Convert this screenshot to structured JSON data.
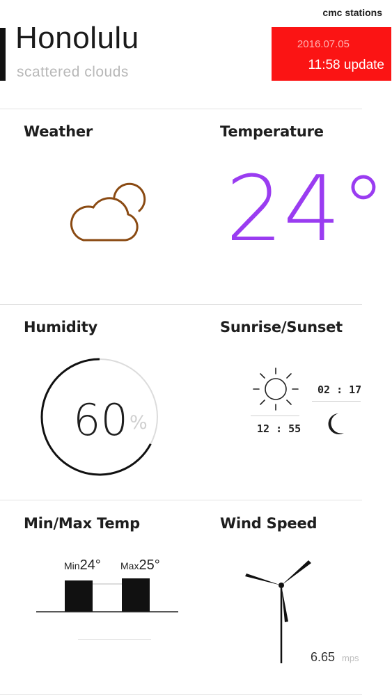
{
  "header": {
    "city": "Honolulu",
    "condition": "scattered clouds",
    "source": "cmc stations",
    "update_date": "2016.07.05",
    "update_time": "11:58 update",
    "update_bg_color": "#fb1414"
  },
  "cards": {
    "weather": {
      "title": "Weather",
      "icon": "cloud-sun-icon",
      "icon_color": "#8a4a12"
    },
    "temperature": {
      "title": "Temperature",
      "value": "24°",
      "color": "#9a3cf1"
    },
    "humidity": {
      "title": "Humidity",
      "value": "60",
      "unit": "%",
      "fraction": 0.6
    },
    "sun": {
      "title": "Sunrise/Sunset",
      "sunrise": "12 : 55",
      "sunset": "02 : 17",
      "sun_icon": "sun-icon",
      "moon_icon": "moon-icon"
    },
    "minmax": {
      "title": "Min/Max Temp",
      "min_label": "Min",
      "min_value": "24°",
      "max_label": "Max",
      "max_value": "25°"
    },
    "wind": {
      "title": "Wind Speed",
      "value": "6.65",
      "unit": "mps",
      "icon": "wind-turbine-icon"
    }
  }
}
